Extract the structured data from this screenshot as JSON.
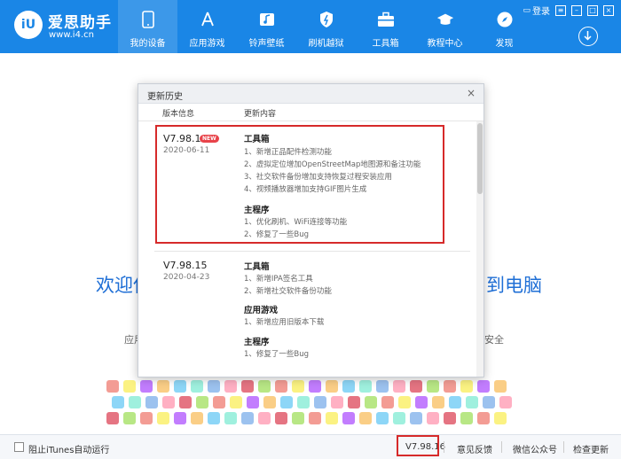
{
  "header": {
    "logo_text": "iU",
    "brand_name": "爱思助手",
    "brand_url": "www.i4.cn",
    "nav": [
      {
        "label": "我的设备",
        "icon": "phone-icon"
      },
      {
        "label": "应用游戏",
        "icon": "app-store-icon"
      },
      {
        "label": "铃声壁纸",
        "icon": "music-icon"
      },
      {
        "label": "刷机越狱",
        "icon": "flash-icon"
      },
      {
        "label": "工具箱",
        "icon": "toolbox-icon"
      },
      {
        "label": "教程中心",
        "icon": "graduation-cap-icon"
      },
      {
        "label": "发现",
        "icon": "compass-icon"
      }
    ],
    "login_label": "登录",
    "colors": {
      "bar": "#1a86e6"
    }
  },
  "background_page": {
    "welcome_left": "欢迎使",
    "welcome_right": "到电脑",
    "sub_left": "应用",
    "sub_right": "安全"
  },
  "dialog": {
    "title": "更新历史",
    "close": "×",
    "col_version": "版本信息",
    "col_content": "更新内容",
    "entries": [
      {
        "version": "V7.98.16",
        "badge": "NEW",
        "date": "2020-06-11",
        "sections": [
          {
            "title": "工具箱",
            "items": [
              "1、新增正品配件检测功能",
              "2、虚拟定位增加OpenStreetMap地图源和备注功能",
              "3、社交软件备份增加支持恢复过程安装应用",
              "4、视频播放器增加支持GIF图片生成"
            ]
          },
          {
            "title": "主程序",
            "items": [
              "1、优化刷机、WiFi连接等功能",
              "2、修复了一些Bug"
            ]
          }
        ]
      },
      {
        "version": "V7.98.15",
        "date": "2020-04-23",
        "sections": [
          {
            "title": "工具箱",
            "items": [
              "1、新增IPA签名工具",
              "2、新增社交软件备份功能"
            ]
          },
          {
            "title": "应用游戏",
            "items": [
              "1、新增应用旧版本下载"
            ]
          },
          {
            "title": "主程序",
            "items": [
              "1、修复了一些Bug"
            ]
          }
        ]
      }
    ]
  },
  "footer": {
    "itunes_label": "阻止iTunes自动运行",
    "version": "V7.98.16",
    "feedback": "意见反馈",
    "wechat": "微信公众号",
    "check_update": "检查更新"
  }
}
